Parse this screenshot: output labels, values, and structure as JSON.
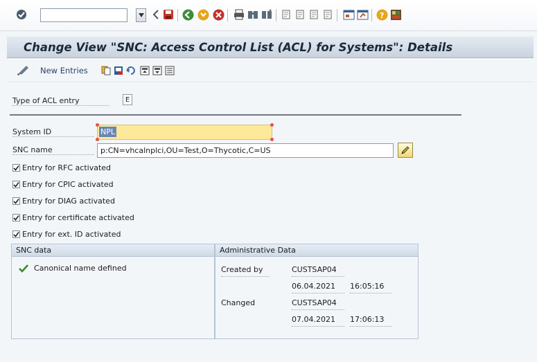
{
  "title": "Change View \"SNC: Access Control List (ACL) for Systems\": Details",
  "app_toolbar": {
    "new_entries_label": "New Entries"
  },
  "form": {
    "type_label": "Type of ACL entry",
    "type_value": "E",
    "system_id_label": "System ID",
    "system_id_value": "NPL",
    "snc_name_label": "SNC name",
    "snc_name_value": "p:CN=vhcalnplci,OU=Test,O=Thycotic,C=US",
    "checkboxes": [
      {
        "label": "Entry for RFC activated",
        "checked": true
      },
      {
        "label": "Entry for CPIC activated",
        "checked": true
      },
      {
        "label": "Entry for DIAG activated",
        "checked": true
      },
      {
        "label": "Entry for certificate activated",
        "checked": true
      },
      {
        "label": "Entry for ext. ID activated",
        "checked": true
      }
    ]
  },
  "snc_data": {
    "header": "SNC data",
    "status_text": "Canonical name defined"
  },
  "admin_data": {
    "header": "Administrative Data",
    "created_by_label": "Created by",
    "created_by_user": "CUSTSAP04",
    "created_date": "06.04.2021",
    "created_time": "16:05:16",
    "changed_label": "Changed",
    "changed_user": "CUSTSAP04",
    "changed_date": "07.04.2021",
    "changed_time": "17:06:13"
  },
  "colors": {
    "accent_check": "#3a8a2c",
    "title_bg": "#c9d3de",
    "required_field": "#fde99a"
  }
}
